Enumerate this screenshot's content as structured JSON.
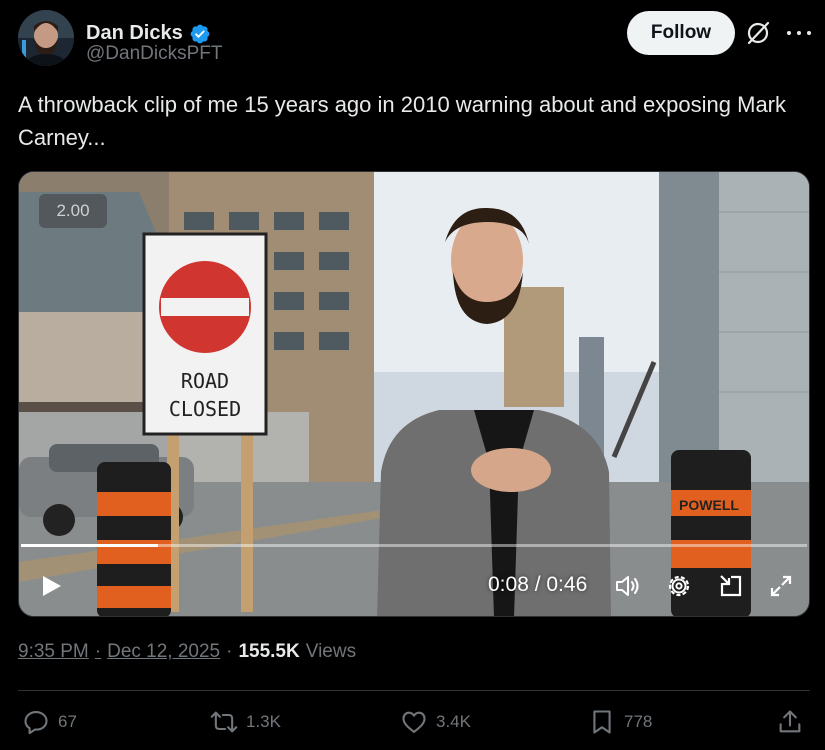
{
  "author": {
    "name": "Dan Dicks",
    "handle": "@DanDicksPFT",
    "verified": true,
    "verified_color": "#1d9bf0"
  },
  "header": {
    "follow_label": "Follow",
    "grok_icon": "grok-icon",
    "more_icon": "more-icon"
  },
  "tweet": {
    "text": "A throwback clip of me 15 years ago in 2010 warning about and exposing Mark Carney..."
  },
  "video": {
    "speed_badge": "2.00",
    "time_display": "0:08 / 0:46",
    "progress": 0.174,
    "sign_text": [
      "ROAD",
      "CLOSED"
    ],
    "barrel_text": "POWELL",
    "controls": [
      "play-icon",
      "volume-icon",
      "settings-icon",
      "pip-icon",
      "fullscreen-icon"
    ]
  },
  "meta": {
    "time": "9:35 PM",
    "separator": "·",
    "date": "Dec 12, 2025",
    "views_count": "155.5K",
    "views_label": "Views"
  },
  "actions": {
    "replies": "67",
    "reposts": "1.3K",
    "likes": "3.4K",
    "bookmarks": "778"
  },
  "colors": {
    "background": "#000000",
    "text": "#e7e9ea",
    "muted": "#71767b",
    "follow_bg": "#eff3f4"
  }
}
